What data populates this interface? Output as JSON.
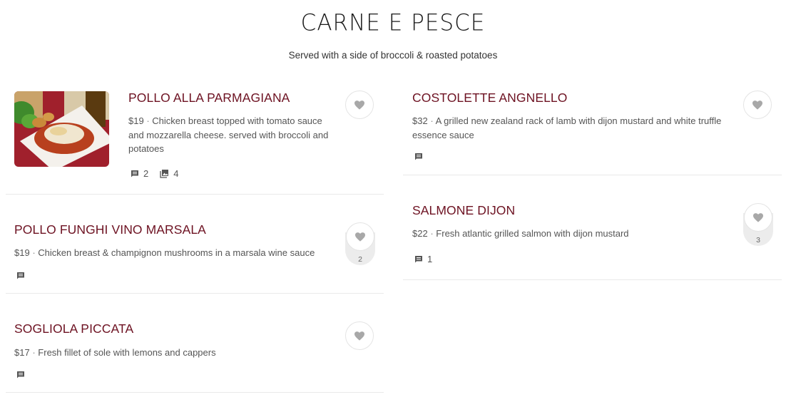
{
  "section": {
    "title": "CARNE E PESCE",
    "subtitle": "Served with a side of broccoli & roasted potatoes"
  },
  "items": [
    {
      "name": "POLLO ALLA PARMAGIANA",
      "price": "$19",
      "sep": "·",
      "description": "Chicken breast topped with tomato sauce and mozzarella cheese. served with broccoli and potatoes",
      "comments": "2",
      "photos": "4",
      "likes": ""
    },
    {
      "name": "POLLO FUNGHI VINO MARSALA",
      "price": "$19",
      "sep": "·",
      "description": "Chicken breast & champignon mushrooms in a marsala wine sauce",
      "comments": "",
      "likes": "2"
    },
    {
      "name": "SOGLIOLA PICCATA",
      "price": "$17",
      "sep": "·",
      "description": "Fresh fillet of sole with lemons and cappers",
      "comments": "",
      "likes": ""
    },
    {
      "name": "COSTOLETTE ANGNELLO",
      "price": "$32",
      "sep": "·",
      "description": "A grilled new zealand rack of lamb with dijon mustard and white truffle essence sauce",
      "comments": "",
      "likes": ""
    },
    {
      "name": "SALMONE DIJON",
      "price": "$22",
      "sep": "·",
      "description": "Fresh atlantic grilled salmon with dijon mustard",
      "comments": "1",
      "likes": "3"
    }
  ],
  "icons": {
    "comment": "comment-icon",
    "photos": "photo-gallery-icon",
    "heart": "heart-icon"
  },
  "colors": {
    "title": "#6d1222",
    "heart": "#a8a8a8",
    "divider": "#e9e9e9"
  }
}
